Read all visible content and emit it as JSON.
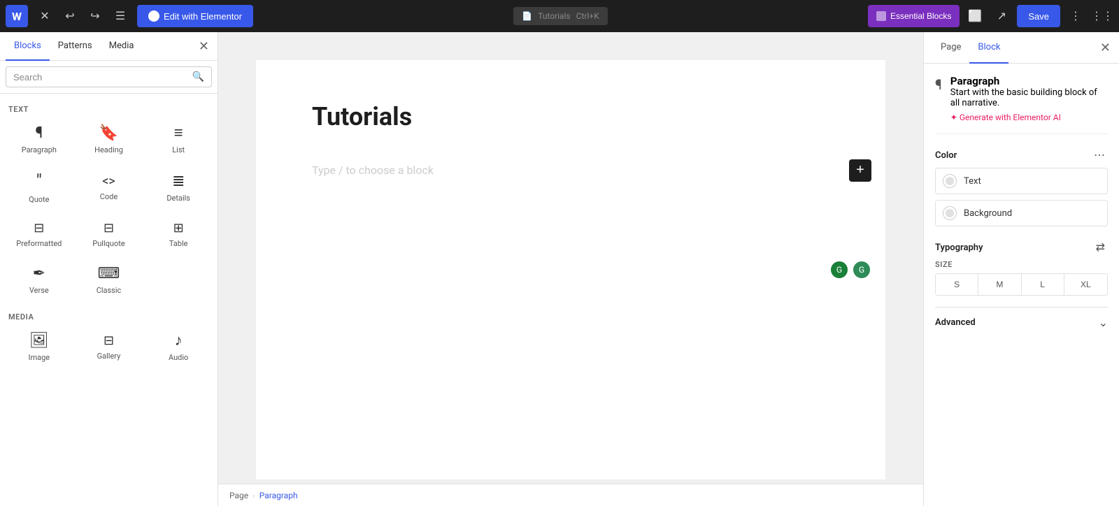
{
  "topbar": {
    "wp_logo": "W",
    "edit_elementor_label": "Edit with Elementor",
    "tutorials_label": "Tutorials",
    "tutorials_shortcut": "Ctrl+K",
    "essential_blocks_label": "Essential Blocks",
    "save_label": "Save"
  },
  "left_sidebar": {
    "tabs": [
      {
        "id": "blocks",
        "label": "Blocks",
        "active": true
      },
      {
        "id": "patterns",
        "label": "Patterns",
        "active": false
      },
      {
        "id": "media",
        "label": "Media",
        "active": false
      }
    ],
    "search_placeholder": "Search",
    "sections": [
      {
        "label": "TEXT",
        "blocks": [
          {
            "icon": "¶",
            "name": "paragraph",
            "label": "Paragraph"
          },
          {
            "icon": "🔖",
            "name": "heading",
            "label": "Heading"
          },
          {
            "icon": "≡",
            "name": "list",
            "label": "List"
          },
          {
            "icon": "❝",
            "name": "quote",
            "label": "Quote"
          },
          {
            "icon": "<>",
            "name": "code",
            "label": "Code"
          },
          {
            "icon": "≣",
            "name": "details",
            "label": "Details"
          },
          {
            "icon": "⊟",
            "name": "preformatted",
            "label": "Preformatted"
          },
          {
            "icon": "⊟",
            "name": "pullquote",
            "label": "Pullquote"
          },
          {
            "icon": "⊞",
            "name": "table",
            "label": "Table"
          },
          {
            "icon": "✒",
            "name": "verse",
            "label": "Verse"
          },
          {
            "icon": "⌨",
            "name": "classic",
            "label": "Classic"
          }
        ]
      },
      {
        "label": "MEDIA",
        "blocks": [
          {
            "icon": "🖼",
            "name": "image",
            "label": "Image"
          },
          {
            "icon": "⊟",
            "name": "gallery",
            "label": "Gallery"
          },
          {
            "icon": "♪",
            "name": "audio",
            "label": "Audio"
          }
        ]
      }
    ]
  },
  "canvas": {
    "page_title": "Tutorials",
    "placeholder_text": "Type / to choose a block"
  },
  "breadcrumb": {
    "page_label": "Page",
    "separator": "›",
    "current_label": "Paragraph"
  },
  "right_panel": {
    "tabs": [
      {
        "id": "page",
        "label": "Page",
        "active": false
      },
      {
        "id": "block",
        "label": "Block",
        "active": true
      }
    ],
    "block_name": "Paragraph",
    "block_description": "Start with the basic building block of all narrative.",
    "generate_label": "✦ Generate with Elementor AI",
    "color_section": {
      "title": "Color",
      "options": [
        {
          "label": "Text"
        },
        {
          "label": "Background"
        }
      ]
    },
    "typography_section": {
      "title": "Typography",
      "size_label": "SIZE",
      "sizes": [
        "S",
        "M",
        "L",
        "XL"
      ]
    },
    "advanced_section": {
      "title": "Advanced"
    }
  }
}
